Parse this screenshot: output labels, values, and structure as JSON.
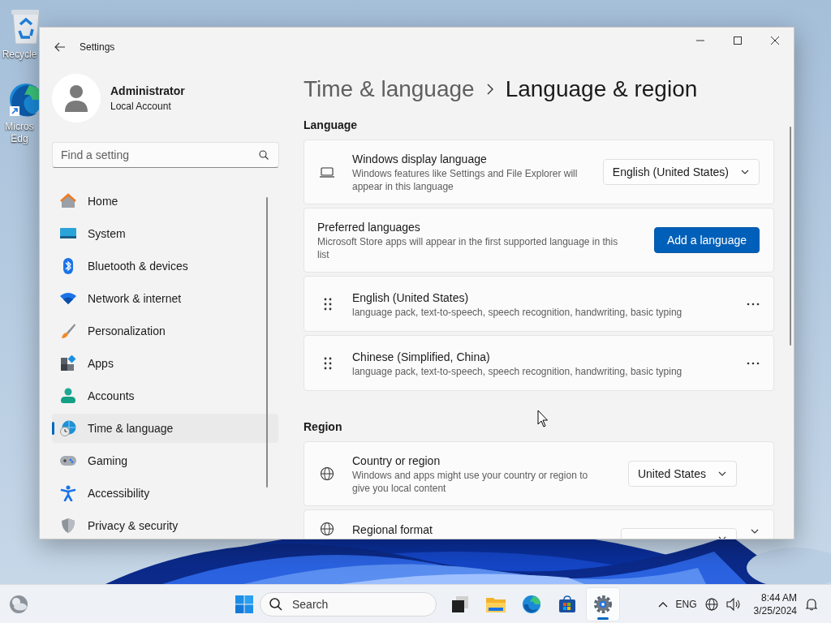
{
  "desktop": {
    "icons": [
      {
        "label": "Recycle"
      },
      {
        "label": "Micros Edg"
      }
    ]
  },
  "window": {
    "title": "Settings"
  },
  "account": {
    "name": "Administrator",
    "type": "Local Account"
  },
  "search": {
    "placeholder": "Find a setting"
  },
  "sidebar": {
    "items": [
      {
        "label": "Home",
        "selected": false
      },
      {
        "label": "System",
        "selected": false
      },
      {
        "label": "Bluetooth & devices",
        "selected": false
      },
      {
        "label": "Network & internet",
        "selected": false
      },
      {
        "label": "Personalization",
        "selected": false
      },
      {
        "label": "Apps",
        "selected": false
      },
      {
        "label": "Accounts",
        "selected": false
      },
      {
        "label": "Time & language",
        "selected": true
      },
      {
        "label": "Gaming",
        "selected": false
      },
      {
        "label": "Accessibility",
        "selected": false
      },
      {
        "label": "Privacy & security",
        "selected": false
      }
    ]
  },
  "breadcrumb": {
    "parent": "Time & language",
    "current": "Language & region"
  },
  "sections": [
    {
      "title": "Language",
      "cards": [
        {
          "kind": "dropdown",
          "title": "Windows display language",
          "description": "Windows features like Settings and File Explorer will appear in this language",
          "value": "English (United States)"
        },
        {
          "kind": "button",
          "title": "Preferred languages",
          "description": "Microsoft Store apps will appear in the first supported language in this list",
          "button": "Add a language"
        },
        {
          "kind": "language",
          "title": "English (United States)",
          "description": "language pack, text-to-speech, speech recognition, handwriting, basic typing"
        },
        {
          "kind": "language",
          "title": "Chinese (Simplified, China)",
          "description": "language pack, text-to-speech, speech recognition, handwriting, basic typing"
        }
      ]
    },
    {
      "title": "Region",
      "cards": [
        {
          "kind": "dropdown",
          "title": "Country or region",
          "description": "Windows and apps might use your country or region to give you local content",
          "value": "United States"
        },
        {
          "kind": "expander",
          "title": "Regional format"
        }
      ]
    }
  ],
  "taskbar": {
    "search_placeholder": "Search",
    "apps": [
      {
        "selected": false
      },
      {
        "selected": false
      },
      {
        "selected": false
      },
      {
        "selected": false
      },
      {
        "selected": true
      }
    ],
    "language": "ENG",
    "time": "8:44 AM",
    "date": "3/25/2024"
  }
}
